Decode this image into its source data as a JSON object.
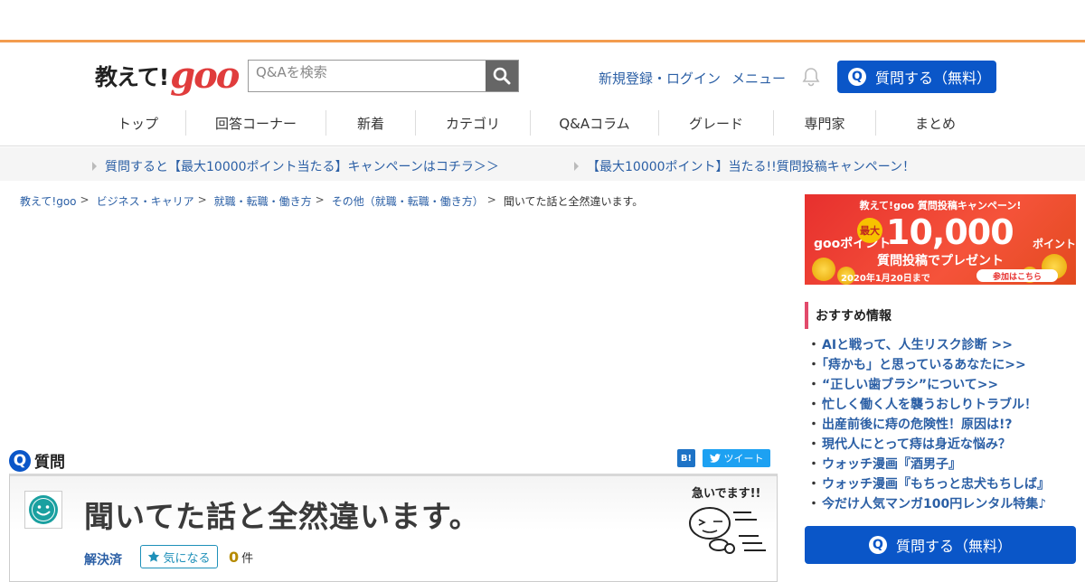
{
  "header": {
    "logo_text": "教えて!",
    "logo_goo": "goo",
    "search_placeholder": "Q&Aを検索",
    "auth_link": "新規登録・ログイン",
    "menu_link": "メニュー",
    "ask_button": "質問する（無料）",
    "q_icon": "Q"
  },
  "nav": {
    "items": [
      "トップ",
      "回答コーナー",
      "新着",
      "カテゴリ",
      "Q&Aコラム",
      "グレード",
      "専門家",
      "まとめ"
    ]
  },
  "campaign": {
    "link1": "質問すると【最大10000ポイント当たる】キャンペーンはコチラ＞＞",
    "link2": "【最大10000ポイント】当たる!!質問投稿キャンペーン！"
  },
  "breadcrumb": {
    "items": [
      "教えて!goo",
      "ビジネス・キャリア",
      "就職・転職・働き方",
      "その他（就職・転職・働き方）"
    ],
    "separator": ">",
    "current": "聞いてた話と全然違います。"
  },
  "question": {
    "section_label": "質問",
    "title": "聞いてた話と全然違います。",
    "status": "解決済",
    "kininaru_label": "気になる",
    "count": "0",
    "count_unit": "件",
    "urgent_label": "急いでます!!",
    "share_hatena": "B!",
    "share_tweet": "ツイート"
  },
  "banner": {
    "top": "教えて!goo 質問投稿キャンペーン!",
    "goo_point": "gooポイント",
    "max": "最大",
    "amount": "10,000",
    "point_unit": "ポイント",
    "sub": "質問投稿でプレゼント",
    "date": "2020年1月20日まで",
    "join": "参加はこちら"
  },
  "recommend": {
    "heading": "おすすめ情報",
    "items": [
      "AIと戦って、人生リスク診断 >>",
      "「痔かも」と思っているあなたに>>",
      "“正しい歯ブラシ”について>>",
      "忙しく働く人を襲うおしりトラブル！",
      "出産前後に痔の危険性！原因は!?",
      "現代人にとって痔は身近な悩み？",
      "ウォッチ漫画『酒男子』",
      "ウォッチ漫画『もちっと忠犬もちしば』",
      "今だけ人気マンガ100円レンタル特集♪"
    ]
  },
  "colors": {
    "accent_blue": "#0a56c8",
    "link_blue": "#2b5fa5",
    "orange_rule": "#f39c4e",
    "logo_red": "#e03c3c"
  }
}
